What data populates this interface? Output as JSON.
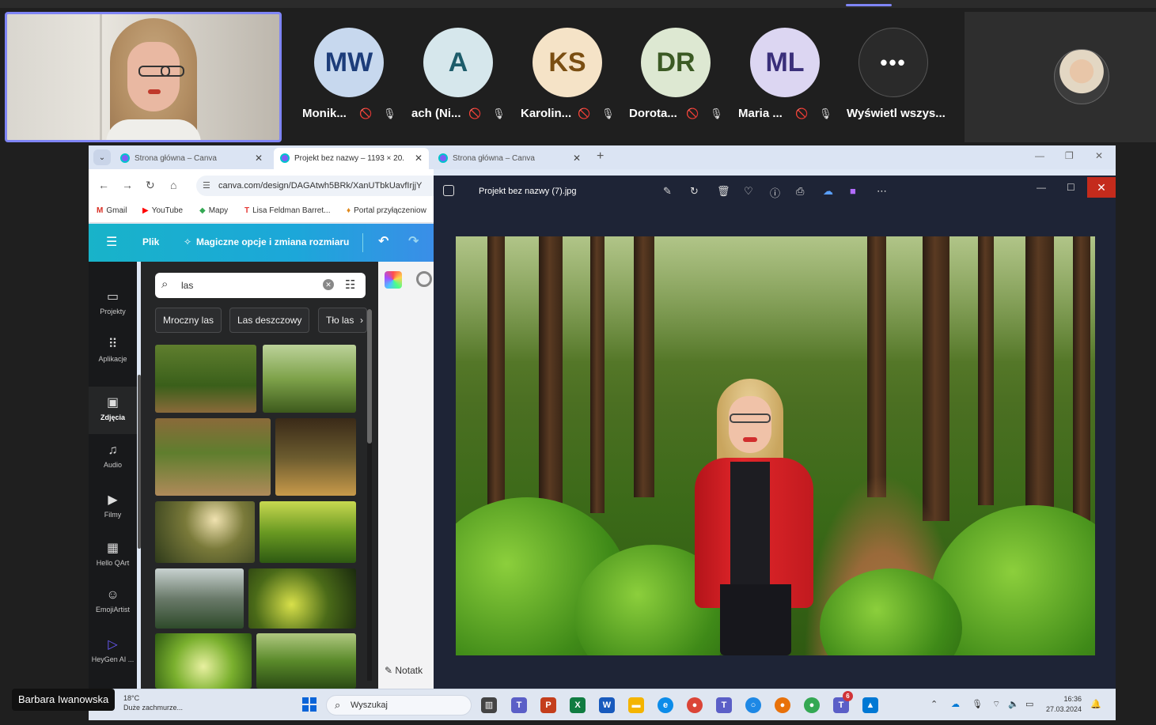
{
  "meeting": {
    "participants": [
      {
        "initials": "MW",
        "name": "Monik...",
        "color": "#c7d8ee",
        "text_color": "#1d3d7a"
      },
      {
        "initials": "A",
        "name": "ach (Ni...",
        "color": "#d6e7ec",
        "text_color": "#1d5c6a"
      },
      {
        "initials": "KS",
        "name": "Karolin...",
        "color": "#f5e3c7",
        "text_color": "#7a4e12"
      },
      {
        "initials": "DR",
        "name": "Dorota...",
        "color": "#dde8d2",
        "text_color": "#3b5a24"
      },
      {
        "initials": "ML",
        "name": "Maria ...",
        "color": "#dcd6f2",
        "text_color": "#3a2f7a"
      }
    ],
    "more": {
      "symbol": "•••",
      "label": "Wyświetl wszys..."
    },
    "presenter_name": "Barbara Iwanowska",
    "accent_color": "#7f85f5"
  },
  "browser": {
    "tabs": [
      {
        "title": "Strona główna – Canva"
      },
      {
        "title": "Projekt bez nazwy – 1193 × 20..."
      },
      {
        "title": "Strona główna – Canva"
      }
    ],
    "url": "canva.com/design/DAGAtwh5BRk/XanUTbkUavfIrjjY",
    "bookmarks": [
      "Gmail",
      "YouTube",
      "Mapy",
      "Lisa Feldman Barret...",
      "Portal przyłączeniow"
    ]
  },
  "canva": {
    "menu": {
      "file": "Plik",
      "magic": "Magiczne opcje i zmiana rozmiaru"
    },
    "sidebar": [
      {
        "label": "Projekty",
        "icon": "folder-icon"
      },
      {
        "label": "Aplikacje",
        "icon": "apps-grid-icon"
      },
      {
        "label": "Zdjęcia",
        "icon": "image-icon"
      },
      {
        "label": "Audio",
        "icon": "music-note-icon"
      },
      {
        "label": "Filmy",
        "icon": "video-icon"
      },
      {
        "label": "Hello QArt",
        "icon": "qr-app-icon"
      },
      {
        "label": "EmojiArtist",
        "icon": "emoji-app-icon"
      },
      {
        "label": "HeyGen AI ...",
        "icon": "heygen-app-icon"
      }
    ],
    "search": {
      "value": "las"
    },
    "chips": [
      "Mroczny las",
      "Las deszczowy",
      "Tło las"
    ],
    "notes_label": "Notatk"
  },
  "viewer": {
    "title": "Projekt bez nazwy (7).jpg"
  },
  "taskbar": {
    "weather_temp": "18°C",
    "weather_desc": "Duże zachmurze...",
    "search_placeholder": "Wyszukaj",
    "time": "16:36",
    "date": "27.03.2024",
    "badge_count": "6"
  }
}
